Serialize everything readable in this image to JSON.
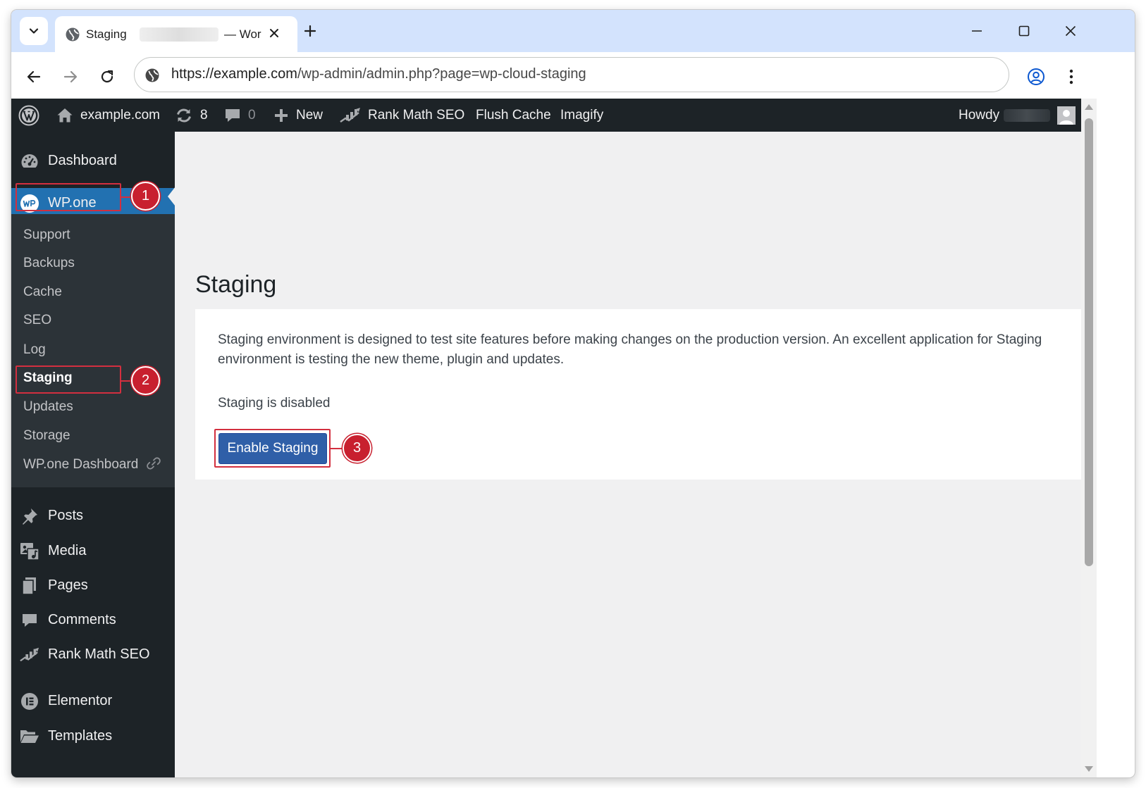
{
  "browser": {
    "tab": {
      "title": "Staging",
      "suffix": "— Wor"
    },
    "address": {
      "url_host": "https://example.com",
      "url_path": "/wp-admin/admin.php?page=wp-cloud-staging"
    }
  },
  "admin_bar": {
    "site_name": "example.com",
    "updates_count": "8",
    "comments_count": "0",
    "new_label": "New",
    "rank_math_label": "Rank Math SEO",
    "flush_cache_label": "Flush Cache",
    "imagify_label": "Imagify",
    "howdy_label": "Howdy"
  },
  "sidebar": {
    "dashboard": "Dashboard",
    "wpone": "WP.one",
    "submenu": {
      "support": "Support",
      "backups": "Backups",
      "cache": "Cache",
      "seo": "SEO",
      "log": "Log",
      "staging": "Staging",
      "updates": "Updates",
      "storage": "Storage",
      "wpone_dashboard": "WP.one Dashboard"
    },
    "posts": "Posts",
    "media": "Media",
    "pages": "Pages",
    "comments": "Comments",
    "rank_math": "Rank Math SEO",
    "elementor": "Elementor",
    "templates": "Templates"
  },
  "main": {
    "title": "Staging",
    "description": "Staging environment is designed to test site features before making changes on the production version. An excellent application for Staging environment is testing the new theme, plugin and updates.",
    "status": "Staging is disabled",
    "enable_button": "Enable Staging"
  },
  "annotations": {
    "step1": "1",
    "step2": "2",
    "step3": "3"
  },
  "colors": {
    "admin_bar_bg": "#1d2327",
    "current_menu_bg": "#2271b1",
    "primary_button": "#2f5fa8",
    "annotation_red": "#c8202f"
  }
}
